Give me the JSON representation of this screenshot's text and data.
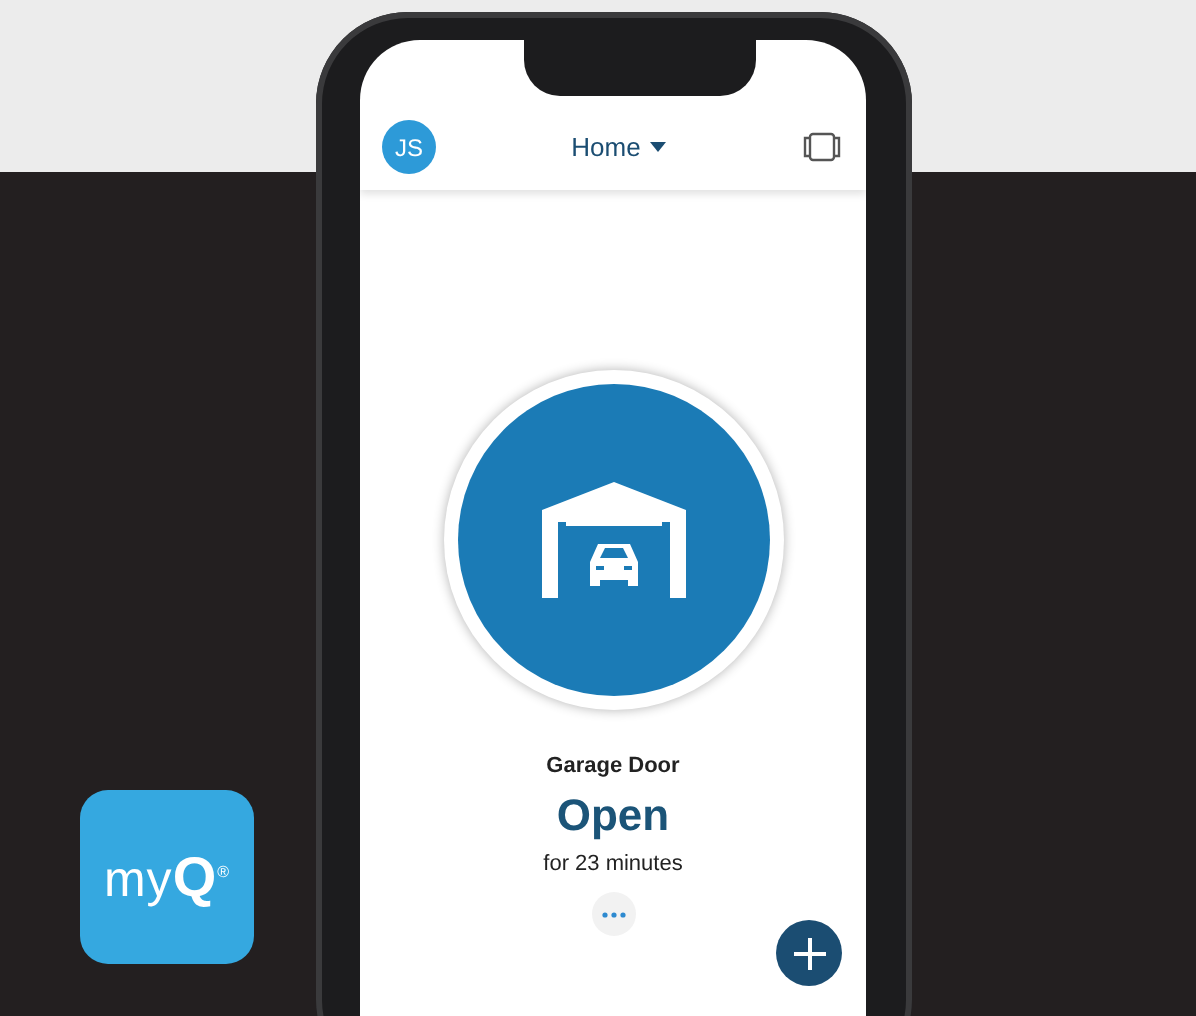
{
  "header": {
    "avatar_initials": "JS",
    "location": "Home"
  },
  "device": {
    "name": "Garage Door",
    "state": "Open",
    "duration": "for 23 minutes"
  },
  "app_icon": {
    "logo": "my**Q**$^{®}$"
  }
}
